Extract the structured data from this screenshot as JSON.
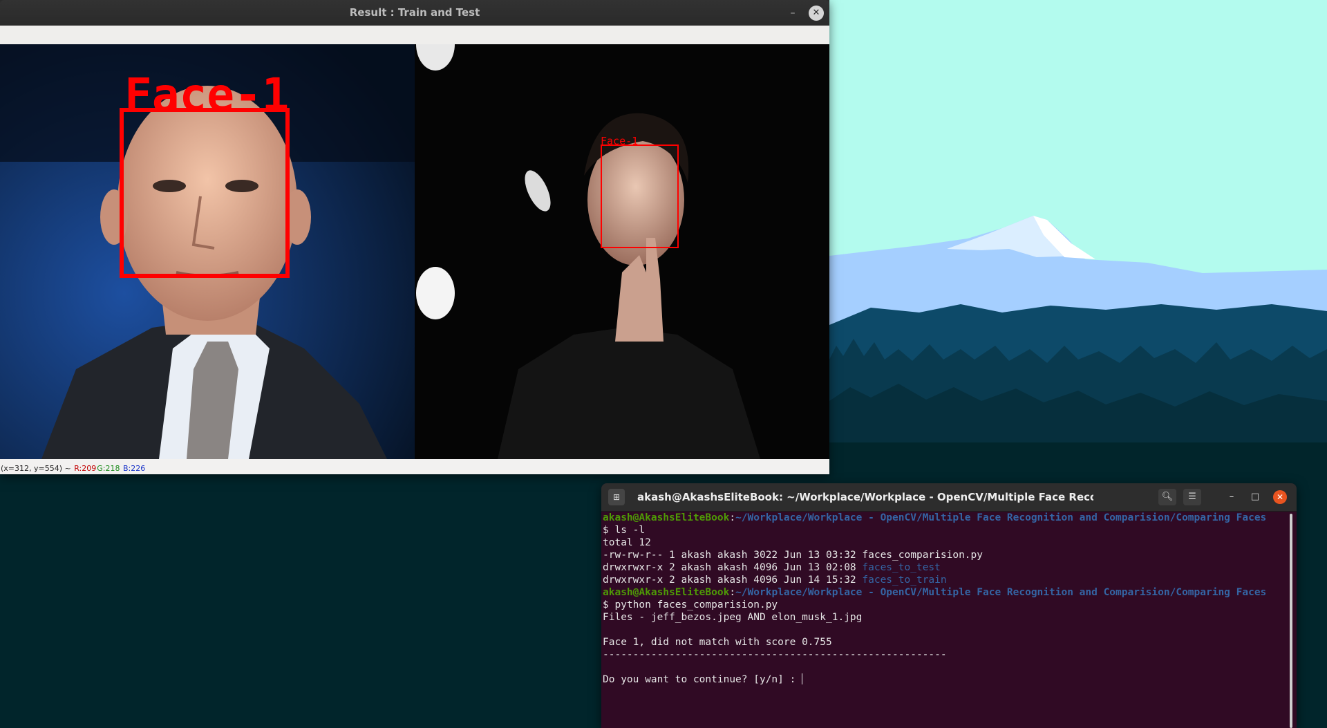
{
  "result_window": {
    "title": "Result : Train and Test",
    "minimize_label": "–",
    "close_label": "✕",
    "status": {
      "coords": "(x=312, y=554) ~",
      "r": "R:209",
      "g": "G:218",
      "b": "B:226"
    },
    "faces": {
      "left_label": "Face-1",
      "right_label": "Face-1"
    },
    "colors": {
      "face_box": "#ff0000"
    }
  },
  "terminal": {
    "title": "akash@AkashsEliteBook: ~/Workplace/Workplace - OpenCV/Multiple Face Recognition and Comparisi...",
    "icons": {
      "new_tab": "new-tab-icon",
      "search": "search-icon",
      "menu": "hamburger-icon",
      "minimize": "minimize-icon",
      "maximize": "maximize-icon",
      "close": "close-icon"
    },
    "prompt_user": "akash@AkashsEliteBook",
    "prompt_path": "~/Workplace/Workplace - OpenCV/Multiple Face Recognition and Comparision/Comparing Faces",
    "cmd1": "$ ls -l",
    "ls_total": "total 12",
    "ls_rows": [
      {
        "meta": "-rw-rw-r-- 1 akash akash 3022 Jun 13 03:32 ",
        "name": "faces_comparision.py",
        "is_dir": false
      },
      {
        "meta": "drwxrwxr-x 2 akash akash 4096 Jun 13 02:08 ",
        "name": "faces_to_test",
        "is_dir": true
      },
      {
        "meta": "drwxrwxr-x 2 akash akash 4096 Jun 14 15:32 ",
        "name": "faces_to_train",
        "is_dir": true
      }
    ],
    "cmd2": "$ python faces_comparision.py",
    "files_line": "Files - jeff_bezos.jpeg AND elon_musk_1.jpg",
    "result_line": "Face 1, did not match with score 0.755",
    "separator": "---------------------------------------------------------",
    "question": "Do you want to continue? [y/n] : ",
    "colors": {
      "background": "#300a24",
      "user": "#4e9a06",
      "path": "#3465a4",
      "close": "#e95420"
    }
  },
  "desktop": {
    "colors": {
      "sky": "#b3fbee",
      "ground": "#01252b"
    }
  }
}
